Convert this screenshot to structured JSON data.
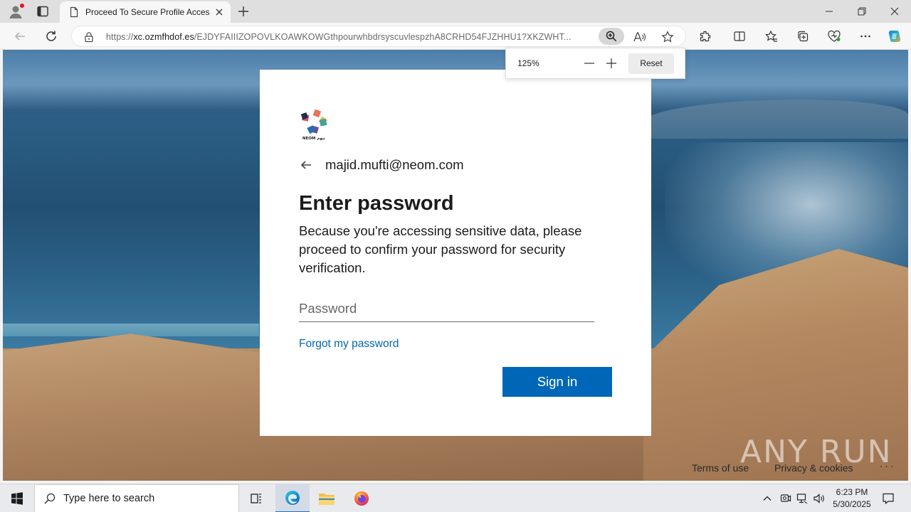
{
  "browser": {
    "tab": {
      "title": "Proceed To Secure Profile Access"
    },
    "address": {
      "url_prefix": "https://",
      "url_host": "xc.ozmfhdof.es",
      "url_path": "/EJDYFAIIIZOPOVLKOAWKOWGthpourwhbdrsyscuvlespzhA8CRHD54FJZHHU1?XKZWHT..."
    },
    "zoom_popup": {
      "level": "125%",
      "reset_label": "Reset"
    }
  },
  "login": {
    "logo_text": "NEOM نيوم",
    "email": "majid.mufti@neom.com",
    "heading": "Enter password",
    "description": "Because you're accessing sensitive data, please proceed to confirm your password for security verification.",
    "password_placeholder": "Password",
    "forgot_label": "Forgot my password",
    "signin_label": "Sign in"
  },
  "footer": {
    "terms": "Terms of use",
    "privacy": "Privacy & cookies",
    "more": ". . .",
    "watermark": "ANY RUN"
  },
  "taskbar": {
    "search_placeholder": "Type here to search",
    "time": "6:23 PM",
    "date": "5/30/2025"
  },
  "colors": {
    "accent": "#0067b8",
    "tabbar": "#dfdfdf",
    "taskbar": "#e8eaee"
  }
}
